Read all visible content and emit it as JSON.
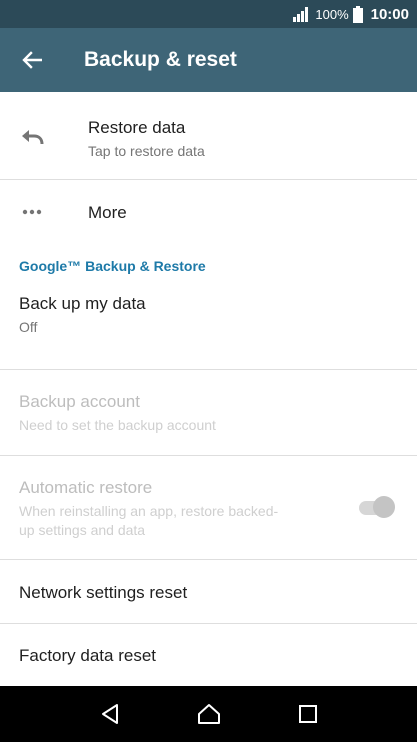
{
  "status_bar": {
    "battery_percent": "100%",
    "time": "10:00"
  },
  "app_bar": {
    "title": "Backup & reset"
  },
  "rows": {
    "restore_data": {
      "title": "Restore data",
      "subtitle": "Tap to restore data"
    },
    "more": {
      "title": "More"
    },
    "section_header": "Google™ Backup & Restore",
    "back_up_my_data": {
      "title": "Back up my data",
      "subtitle": "Off"
    },
    "backup_account": {
      "title": "Backup account",
      "subtitle": "Need to set the backup account"
    },
    "automatic_restore": {
      "title": "Automatic restore",
      "subtitle_line1": "When reinstalling an app, restore backed-",
      "subtitle_line2": "up settings and data",
      "toggle_on": true,
      "enabled": false
    },
    "network_settings_reset": {
      "title": "Network settings reset"
    },
    "factory_data_reset": {
      "title": "Factory data reset"
    }
  },
  "colors": {
    "status_bar": "#2c4a58",
    "app_bar": "#3e6577",
    "section_header": "#1e7aa8"
  }
}
